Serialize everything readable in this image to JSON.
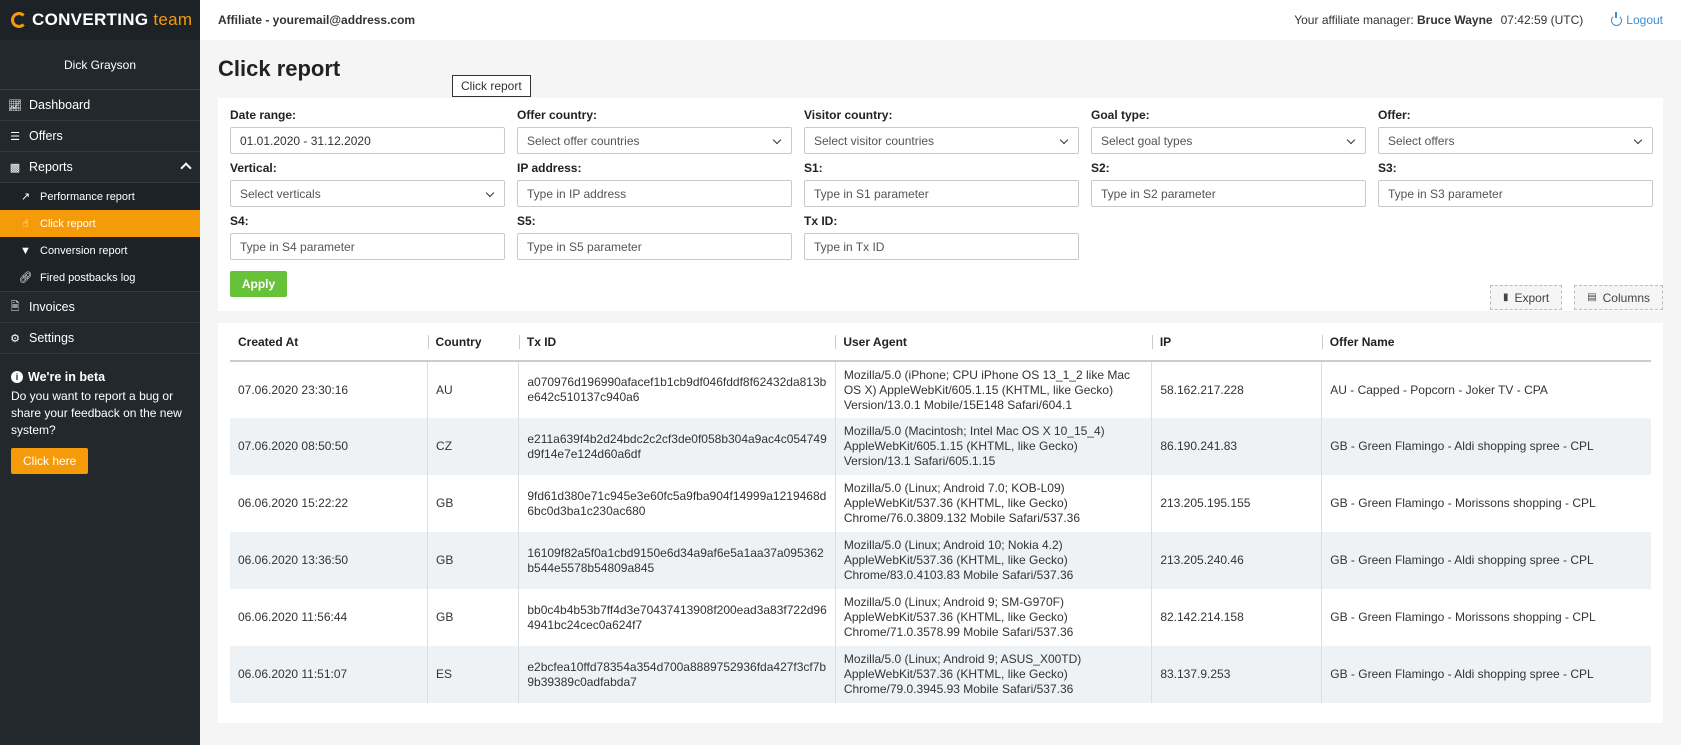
{
  "sidebar": {
    "logo_main": "CONVERTING",
    "logo_accent": "team",
    "user_name": "Dick Grayson",
    "nav": {
      "dashboard": "Dashboard",
      "offers": "Offers",
      "reports": "Reports",
      "invoices": "Invoices",
      "settings": "Settings"
    },
    "reports_sub": {
      "performance": "Performance report",
      "click": "Click report",
      "conversion": "Conversion report",
      "postbacks": "Fired postbacks log"
    },
    "beta": {
      "title": "We're in beta",
      "text": "Do you want to report a bug or share your feedback on the new system?",
      "button": "Click here"
    }
  },
  "topbar": {
    "affiliate": "Affiliate - youremail@address.com",
    "manager_label": "Your affiliate manager:",
    "manager_name": "Bruce Wayne",
    "time": "07:42:59 (UTC)",
    "logout": "Logout"
  },
  "page": {
    "title": "Click report",
    "tooltip": "Click report"
  },
  "filters": {
    "date_range": {
      "label": "Date range:",
      "value": "01.01.2020 - 31.12.2020"
    },
    "offer_country": {
      "label": "Offer country:",
      "placeholder": "Select offer countries"
    },
    "visitor_country": {
      "label": "Visitor country:",
      "placeholder": "Select visitor countries"
    },
    "goal_type": {
      "label": "Goal type:",
      "placeholder": "Select goal types"
    },
    "offer": {
      "label": "Offer:",
      "placeholder": "Select offers"
    },
    "vertical": {
      "label": "Vertical:",
      "placeholder": "Select verticals"
    },
    "ip": {
      "label": "IP address:",
      "placeholder": "Type in IP address"
    },
    "s1": {
      "label": "S1:",
      "placeholder": "Type in S1 parameter"
    },
    "s2": {
      "label": "S2:",
      "placeholder": "Type in S2 parameter"
    },
    "s3": {
      "label": "S3:",
      "placeholder": "Type in S3 parameter"
    },
    "s4": {
      "label": "S4:",
      "placeholder": "Type in S4 parameter"
    },
    "s5": {
      "label": "S5:",
      "placeholder": "Type in S5 parameter"
    },
    "txid": {
      "label": "Tx ID:",
      "placeholder": "Type in Tx ID"
    },
    "apply": "Apply"
  },
  "tools": {
    "export": "Export",
    "columns": "Columns"
  },
  "table": {
    "headers": [
      "Created At",
      "Country",
      "Tx ID",
      "User Agent",
      "IP",
      "Offer Name"
    ],
    "rows": [
      [
        "07.06.2020 23:30:16",
        "AU",
        "a070976d196990afacef1b1cb9df046fddf8f62432da813be642c510137c940a6",
        "Mozilla/5.0 (iPhone; CPU iPhone OS 13_1_2 like Mac OS X) AppleWebKit/605.1.15 (KHTML, like Gecko) Version/13.0.1 Mobile/15E148 Safari/604.1",
        "58.162.217.228",
        "AU - Capped - Popcorn - Joker TV - CPA"
      ],
      [
        "07.06.2020 08:50:50",
        "CZ",
        "e211a639f4b2d24bdc2c2cf3de0f058b304a9ac4c054749d9f14e7e124d60a6df",
        "Mozilla/5.0 (Macintosh; Intel Mac OS X 10_15_4) AppleWebKit/605.1.15 (KHTML, like Gecko) Version/13.1 Safari/605.1.15",
        "86.190.241.83",
        "GB - Green Flamingo - Aldi shopping spree - CPL"
      ],
      [
        "06.06.2020 15:22:22",
        "GB",
        "9fd61d380e71c945e3e60fc5a9fba904f14999a1219468d6bc0d3ba1c230ac680",
        "Mozilla/5.0 (Linux; Android 7.0; KOB-L09) AppleWebKit/537.36 (KHTML, like Gecko) Chrome/76.0.3809.132 Mobile Safari/537.36",
        "213.205.195.155",
        "GB - Green Flamingo - Morissons shopping - CPL"
      ],
      [
        "06.06.2020 13:36:50",
        "GB",
        "16109f82a5f0a1cbd9150e6d34a9af6e5a1aa37a095362b544e5578b54809a845",
        "Mozilla/5.0 (Linux; Android 10; Nokia 4.2) AppleWebKit/537.36 (KHTML, like Gecko) Chrome/83.0.4103.83 Mobile Safari/537.36",
        "213.205.240.46",
        "GB - Green Flamingo - Aldi shopping spree - CPL"
      ],
      [
        "06.06.2020 11:56:44",
        "GB",
        "bb0c4b4b53b7ff4d3e70437413908f200ead3a83f722d964941bc24cec0a624f7",
        "Mozilla/5.0 (Linux; Android 9; SM-G970F) AppleWebKit/537.36 (KHTML, like Gecko) Chrome/71.0.3578.99 Mobile Safari/537.36",
        "82.142.214.158",
        "GB - Green Flamingo - Morissons shopping - CPL"
      ],
      [
        "06.06.2020 11:51:07",
        "ES",
        "e2bcfea10ffd78354a354d700a8889752936fda427f3cf7b9b39389c0adfabda7",
        "Mozilla/5.0 (Linux; Android 9; ASUS_X00TD) AppleWebKit/537.36 (KHTML, like Gecko) Chrome/79.0.3945.93 Mobile Safari/537.36",
        "83.137.9.253",
        "GB - Green Flamingo - Aldi shopping spree - CPL"
      ]
    ]
  }
}
